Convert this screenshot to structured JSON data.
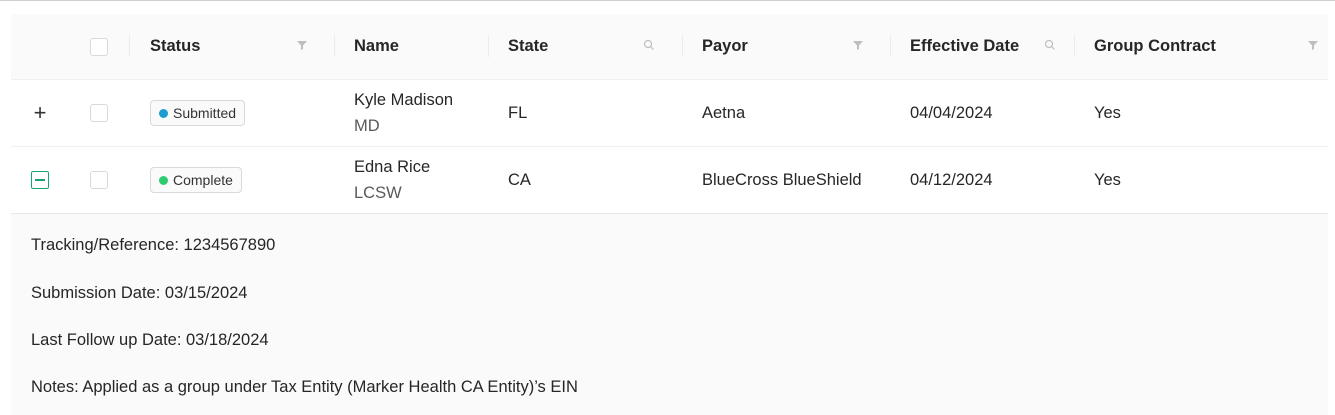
{
  "table": {
    "columns": {
      "status": "Status",
      "name": "Name",
      "state": "State",
      "payor": "Payor",
      "effective_date": "Effective Date",
      "group_contract": "Group Contract"
    },
    "rows": [
      {
        "expand_symbol": "+",
        "status": "Submitted",
        "status_color": "#1c9dcf",
        "name": "Kyle Madison",
        "credential": "MD",
        "state": "FL",
        "payor": "Aetna",
        "effective_date": "04/04/2024",
        "group_contract": "Yes"
      },
      {
        "expand_symbol": "−",
        "status": "Complete",
        "status_color": "#2ecc71",
        "name": "Edna Rice",
        "credential": "LCSW",
        "state": "CA",
        "payor": "BlueCross BlueShield",
        "effective_date": "04/12/2024",
        "group_contract": "Yes"
      }
    ]
  },
  "detail": {
    "tracking": "Tracking/Reference: 1234567890",
    "submission_date": "Submission Date: 03/15/2024",
    "last_follow_up": "Last Follow up Date: 03/18/2024",
    "notes": "Notes: Applied as a group under Tax Entity (Marker Health CA Entity)’s EIN"
  },
  "icons": {
    "filter": "filter-icon",
    "search": "search-icon",
    "expand": "plus-icon",
    "collapse": "minus-square-icon"
  },
  "colors": {
    "accent": "#17a673",
    "submitted_dot": "#1c9dcf",
    "complete_dot": "#2ecc71"
  }
}
